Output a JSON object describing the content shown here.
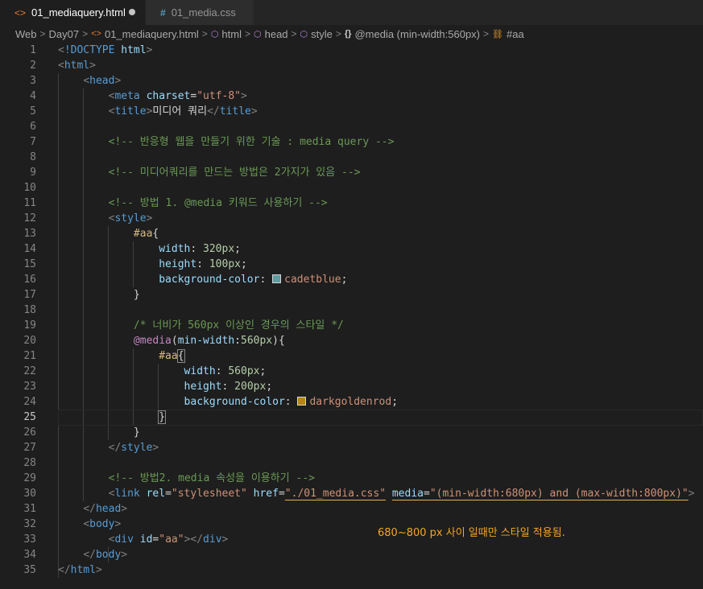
{
  "tabs": [
    {
      "label": "01_mediaquery.html",
      "icon": "html-file-icon",
      "active": true,
      "dirty": true
    },
    {
      "label": "01_media.css",
      "icon": "css-file-icon",
      "active": false
    }
  ],
  "breadcrumb": [
    "Web",
    "Day07",
    "01_mediaquery.html",
    "html",
    "head",
    "style",
    "@media (min-width:560px)",
    "#aa"
  ],
  "editor": {
    "current_line": 25,
    "lines": [
      [
        [
          "t-punc",
          "<"
        ],
        [
          "t-tag",
          "!DOCTYPE "
        ],
        [
          "t-attr",
          "html"
        ],
        [
          "t-punc",
          ">"
        ]
      ],
      [
        [
          "t-punc",
          "<"
        ],
        [
          "t-tag",
          "html"
        ],
        [
          "t-punc",
          ">"
        ]
      ],
      [
        [
          "t-text",
          "    "
        ],
        [
          "t-punc",
          "<"
        ],
        [
          "t-tag",
          "head"
        ],
        [
          "t-punc",
          ">"
        ]
      ],
      [
        [
          "t-text",
          "        "
        ],
        [
          "t-punc",
          "<"
        ],
        [
          "t-tag",
          "meta "
        ],
        [
          "t-attr",
          "charset"
        ],
        [
          "t-text",
          "="
        ],
        [
          "t-val",
          "\"utf-8\""
        ],
        [
          "t-punc",
          ">"
        ]
      ],
      [
        [
          "t-text",
          "        "
        ],
        [
          "t-punc",
          "<"
        ],
        [
          "t-tag",
          "title"
        ],
        [
          "t-punc",
          ">"
        ],
        [
          "t-text",
          "미디어 쿼리"
        ],
        [
          "t-punc",
          "</"
        ],
        [
          "t-tag",
          "title"
        ],
        [
          "t-punc",
          ">"
        ]
      ],
      [],
      [
        [
          "t-text",
          "        "
        ],
        [
          "t-com",
          "<!-- 반응형 웹을 만들기 위한 기술 : media query -->"
        ]
      ],
      [],
      [
        [
          "t-text",
          "        "
        ],
        [
          "t-com",
          "<!-- 미디어쿼리를 만드는 방법은 2가지가 있음 -->"
        ]
      ],
      [],
      [
        [
          "t-text",
          "        "
        ],
        [
          "t-com",
          "<!-- 방법 1. @media 키워드 사용하기 -->"
        ]
      ],
      [
        [
          "t-text",
          "        "
        ],
        [
          "t-punc",
          "<"
        ],
        [
          "t-tag",
          "style"
        ],
        [
          "t-punc",
          ">"
        ]
      ],
      [
        [
          "t-text",
          "            "
        ],
        [
          "t-sel",
          "#aa"
        ],
        [
          "t-text",
          "{"
        ]
      ],
      [
        [
          "t-text",
          "                "
        ],
        [
          "t-prop",
          "width"
        ],
        [
          "t-text",
          ": "
        ],
        [
          "t-num",
          "320px"
        ],
        [
          "t-text",
          ";"
        ]
      ],
      [
        [
          "t-text",
          "                "
        ],
        [
          "t-prop",
          "height"
        ],
        [
          "t-text",
          ": "
        ],
        [
          "t-num",
          "100px"
        ],
        [
          "t-text",
          ";"
        ]
      ],
      [
        [
          "t-text",
          "                "
        ],
        [
          "t-prop",
          "background-color"
        ],
        [
          "t-text",
          ": "
        ],
        [
          "swatch",
          "#5f9ea0"
        ],
        [
          "t-val",
          "cadetblue"
        ],
        [
          "t-text",
          ";"
        ]
      ],
      [
        [
          "t-text",
          "            }"
        ]
      ],
      [],
      [
        [
          "t-text",
          "            "
        ],
        [
          "t-com",
          "/* 너비가 560px 이상인 경우의 스타일 */"
        ]
      ],
      [
        [
          "t-text",
          "            "
        ],
        [
          "t-kw",
          "@media"
        ],
        [
          "t-text",
          "("
        ],
        [
          "t-prop",
          "min-width"
        ],
        [
          "t-text",
          ":"
        ],
        [
          "t-num",
          "560px"
        ],
        [
          "t-text",
          "){"
        ]
      ],
      [
        [
          "t-text",
          "                "
        ],
        [
          "t-sel",
          "#aa"
        ],
        [
          "bracket",
          "{"
        ]
      ],
      [
        [
          "t-text",
          "                    "
        ],
        [
          "t-prop",
          "width"
        ],
        [
          "t-text",
          ": "
        ],
        [
          "t-num",
          "560px"
        ],
        [
          "t-text",
          ";"
        ]
      ],
      [
        [
          "t-text",
          "                    "
        ],
        [
          "t-prop",
          "height"
        ],
        [
          "t-text",
          ": "
        ],
        [
          "t-num",
          "200px"
        ],
        [
          "t-text",
          ";"
        ]
      ],
      [
        [
          "t-text",
          "                    "
        ],
        [
          "t-prop",
          "background-color"
        ],
        [
          "t-text",
          ": "
        ],
        [
          "swatch",
          "#b8860b"
        ],
        [
          "t-val",
          "darkgoldenrod"
        ],
        [
          "t-text",
          ";"
        ]
      ],
      [
        [
          "t-text",
          "                "
        ],
        [
          "bracket",
          "}"
        ]
      ],
      [
        [
          "t-text",
          "            }"
        ]
      ],
      [
        [
          "t-text",
          "        "
        ],
        [
          "t-punc",
          "</"
        ],
        [
          "t-tag",
          "style"
        ],
        [
          "t-punc",
          ">"
        ]
      ],
      [],
      [
        [
          "t-text",
          "        "
        ],
        [
          "t-com",
          "<!-- 방법2. media 속성을 이용하기 -->"
        ]
      ],
      [
        [
          "t-text",
          "        "
        ],
        [
          "t-punc",
          "<"
        ],
        [
          "t-tag",
          "link "
        ],
        [
          "t-attr",
          "rel"
        ],
        [
          "t-text",
          "="
        ],
        [
          "t-val",
          "\"stylesheet\""
        ],
        [
          "t-text",
          " "
        ],
        [
          "t-attr",
          "href"
        ],
        [
          "t-text",
          "="
        ],
        [
          "t-val-ul",
          "\"./01_media.css\""
        ],
        [
          "t-text",
          " "
        ],
        [
          "t-attr-ul",
          "media"
        ],
        [
          "t-text-ul",
          "="
        ],
        [
          "t-val-ul",
          "\"(min-width:680px) and (max-width:800px)\""
        ],
        [
          "t-punc",
          ">"
        ]
      ],
      [
        [
          "t-text",
          "    "
        ],
        [
          "t-punc",
          "</"
        ],
        [
          "t-tag",
          "head"
        ],
        [
          "t-punc",
          ">"
        ]
      ],
      [
        [
          "t-text",
          "    "
        ],
        [
          "t-punc",
          "<"
        ],
        [
          "t-tag",
          "body"
        ],
        [
          "t-punc",
          ">"
        ]
      ],
      [
        [
          "t-text",
          "        "
        ],
        [
          "t-punc",
          "<"
        ],
        [
          "t-tag",
          "div "
        ],
        [
          "t-attr",
          "id"
        ],
        [
          "t-text",
          "="
        ],
        [
          "t-val",
          "\"aa\""
        ],
        [
          "t-punc",
          "></"
        ],
        [
          "t-tag",
          "div"
        ],
        [
          "t-punc",
          ">"
        ]
      ],
      [
        [
          "t-text",
          "    "
        ],
        [
          "t-punc",
          "</"
        ],
        [
          "t-tag",
          "body"
        ],
        [
          "t-punc",
          ">"
        ]
      ],
      [
        [
          "t-punc",
          "</"
        ],
        [
          "t-tag",
          "html"
        ],
        [
          "t-punc",
          ">"
        ]
      ]
    ]
  },
  "annotation": "680~800 px 사이 일때만 스타일 적용됨."
}
